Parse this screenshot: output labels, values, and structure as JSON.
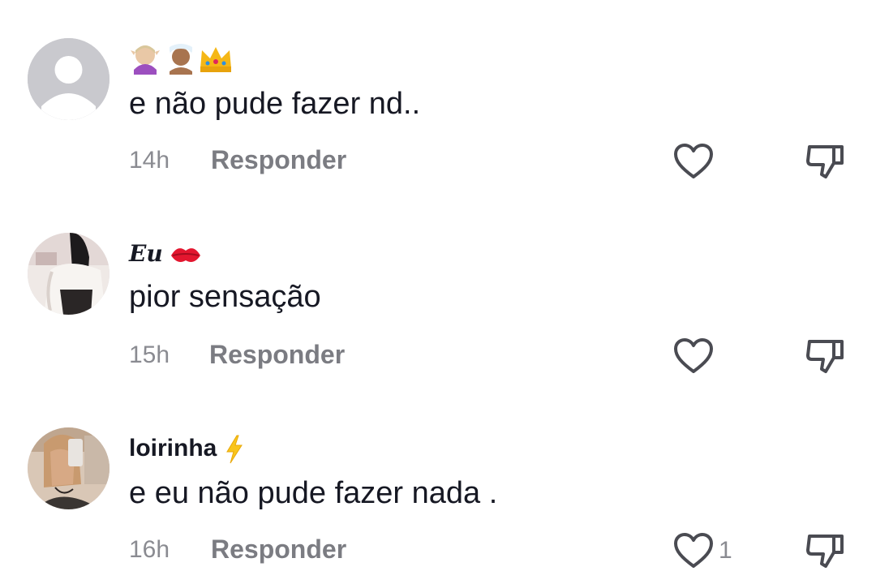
{
  "comments": [
    {
      "username": "🧝🏼‍♀️🧖🏽‍♂️👑",
      "username_icons": [
        "elf-woman-emoji",
        "person-in-steamy-room-emoji",
        "crown-emoji"
      ],
      "text": "e não pude fazer nd..",
      "time": "14h",
      "reply_label": "Responder",
      "like_count": ""
    },
    {
      "username": "𝓔𝓾💋",
      "username_text": "Eu",
      "username_icons": [
        "kiss-mark-emoji"
      ],
      "text": "pior sensação",
      "time": "15h",
      "reply_label": "Responder",
      "like_count": ""
    },
    {
      "username": "loirinha⚡",
      "username_text": "loirinha",
      "username_icons": [
        "lightning-emoji"
      ],
      "text": "e eu não pude fazer nada .",
      "time": "16h",
      "reply_label": "Responder",
      "like_count": "1"
    }
  ],
  "colors": {
    "text_primary": "#161823",
    "text_secondary": "#8a8b91",
    "reply": "#7b7c82",
    "icon": "#4a4b52",
    "default_avatar_bg": "#c7c7cc"
  }
}
